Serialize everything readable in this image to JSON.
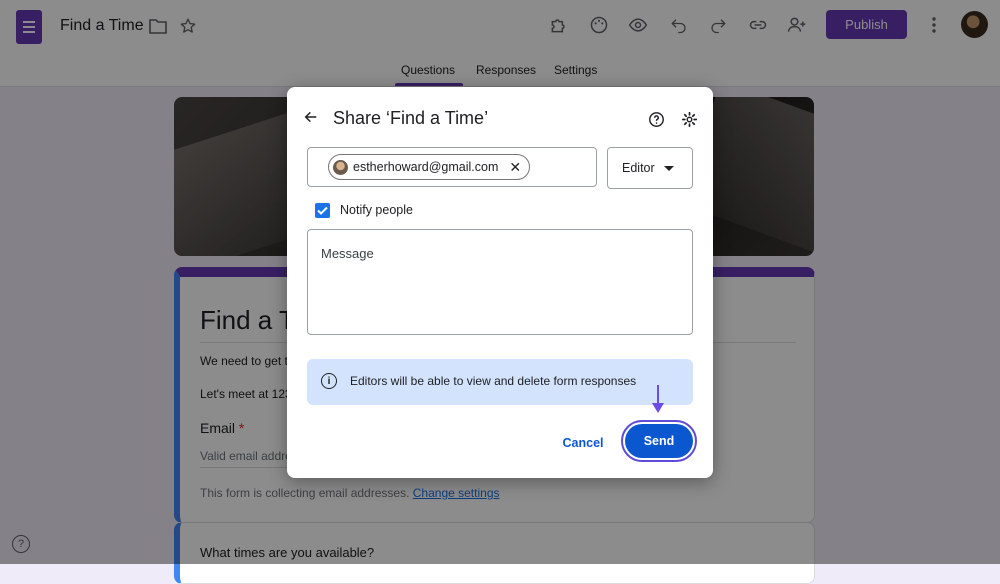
{
  "app": {
    "doc_title": "Find a Time",
    "publish_label": "Publish",
    "tabs": [
      {
        "label": "Questions",
        "active": true
      },
      {
        "label": "Responses",
        "active": false
      },
      {
        "label": "Settings",
        "active": false
      }
    ],
    "toolbar_icons": [
      "addons-icon",
      "palette-icon",
      "preview-eye-icon",
      "undo-icon",
      "redo-icon",
      "link-icon",
      "add-collaborator-icon",
      "more-vert-icon"
    ],
    "accent_color": "#673ab7"
  },
  "form": {
    "title": "Find a T",
    "desc_line1": "We need to get to",
    "desc_line2": "Let's meet at 123",
    "email_label": "Email",
    "required_mark": "*",
    "email_placeholder": "Valid email addre",
    "collecting_note": "This form is collecting email addresses.",
    "change_settings_link": "Change settings",
    "question2": "What times are you available?"
  },
  "share_dialog": {
    "title": "Share ‘Find a Time’",
    "chip_email": "estherhoward@gmail.com",
    "role": "Editor",
    "notify_label": "Notify people",
    "notify_checked": true,
    "message_placeholder": "Message",
    "info_text": "Editors will be able to view and delete form responses",
    "cancel_label": "Cancel",
    "send_label": "Send",
    "send_color": "#0b57d0",
    "info_bg": "#d3e3fd"
  }
}
